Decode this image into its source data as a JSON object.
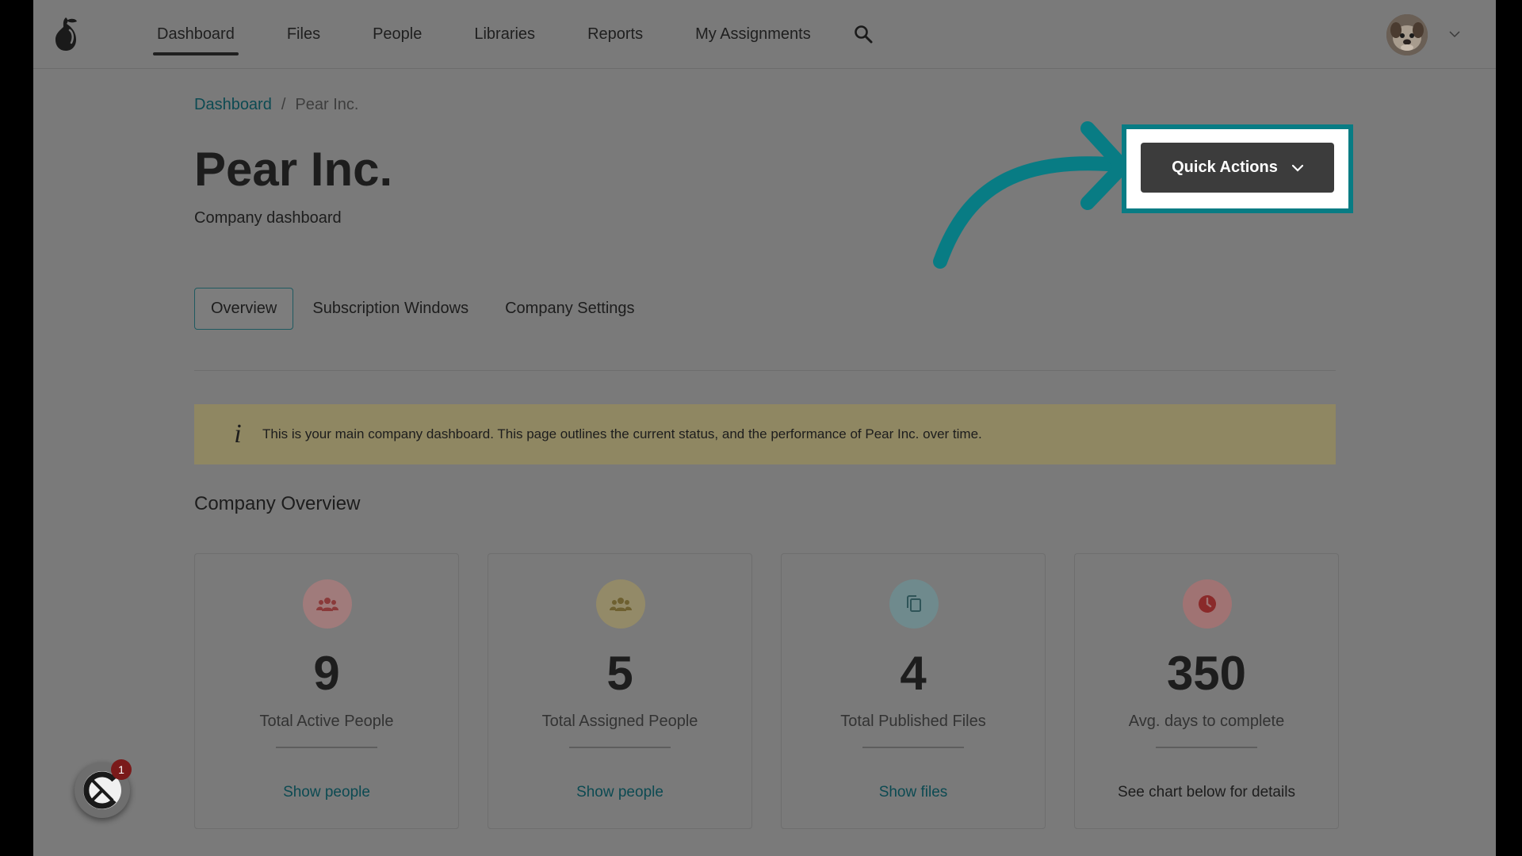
{
  "nav": {
    "items": [
      {
        "label": "Dashboard",
        "active": true
      },
      {
        "label": "Files"
      },
      {
        "label": "People"
      },
      {
        "label": "Libraries"
      },
      {
        "label": "Reports"
      },
      {
        "label": "My Assignments"
      }
    ],
    "search_icon": "search-icon",
    "logo_icon": "pear-logo-icon"
  },
  "breadcrumb": {
    "items": [
      "Dashboard",
      "Pear Inc."
    ],
    "separator": "/"
  },
  "page": {
    "title": "Pear Inc.",
    "subtitle": "Company dashboard"
  },
  "quick_actions": {
    "label": "Quick Actions",
    "icon": "chevron-down-icon",
    "highlight_color": "#087c84"
  },
  "tabs": [
    {
      "label": "Overview",
      "active": true
    },
    {
      "label": "Subscription Windows"
    },
    {
      "label": "Company Settings"
    }
  ],
  "info_banner": {
    "icon": "info-icon",
    "glyph": "i",
    "text": "This is your main company dashboard. This page outlines the current status, and the performance of Pear Inc. over time."
  },
  "overview": {
    "title": "Company Overview",
    "cards": [
      {
        "icon": "people-group-icon",
        "value": "9",
        "label": "Total Active People",
        "link": "Show people",
        "icon_color": "#9a5d5d"
      },
      {
        "icon": "people-group-icon",
        "value": "5",
        "label": "Total Assigned People",
        "link": "Show people",
        "icon_color": "#8f8150"
      },
      {
        "icon": "copy-files-icon",
        "value": "4",
        "label": "Total Published Files",
        "link": "Show files",
        "icon_color": "#5e7b80"
      },
      {
        "icon": "clock-icon",
        "value": "350",
        "label": "Avg. days to complete",
        "link": "See chart below for details",
        "icon_color": "#8e4e4e"
      }
    ]
  },
  "widget": {
    "badge": "1",
    "icon": "chat-widget-icon"
  },
  "colors": {
    "link": "#0c4a52",
    "banner": "#8f8762",
    "button": "#3c3c3c"
  }
}
